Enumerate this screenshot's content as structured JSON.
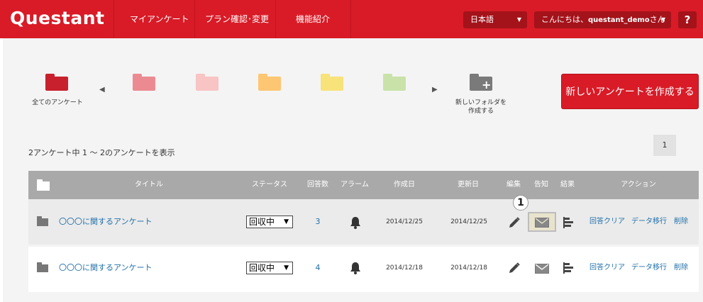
{
  "header": {
    "logo": "Questant",
    "nav": [
      "マイアンケート",
      "プラン確認･変更",
      "機能紹介"
    ],
    "language": "日本語",
    "greeting_prefix": "こんにちは、",
    "username": "questant_demo",
    "greeting_suffix": "さん",
    "help": "?"
  },
  "folders": {
    "all_label": "全てのアンケート",
    "new_label_1": "新しいフォルダを",
    "new_label_2": "作成する",
    "colors": [
      "#c8202d",
      "#eb8b91",
      "#f8c4c4",
      "#fdc672",
      "#f8e27a",
      "#c9e2a9",
      "#7a7a7a"
    ]
  },
  "create_button": "新しいアンケートを作成する",
  "count_text": "2アンケート中  1 ～ 2のアンケートを表示",
  "pagination": {
    "current": "1"
  },
  "table": {
    "headers": {
      "title": "タイトル",
      "status": "ステータス",
      "responses": "回答数",
      "alarm": "アラーム",
      "created": "作成日",
      "updated": "更新日",
      "edit": "編集",
      "notify": "告知",
      "results": "結果",
      "actions": "アクション"
    },
    "rows": [
      {
        "title": "〇〇〇に関するアンケート",
        "status": "回収中",
        "responses": "3",
        "created": "2014/12/25",
        "updated": "2014/12/25",
        "actions": [
          "回答クリア",
          "データ移行",
          "削除"
        ]
      },
      {
        "title": "〇〇〇に関するアンケート",
        "status": "回収中",
        "responses": "4",
        "created": "2014/12/18",
        "updated": "2014/12/18",
        "actions": [
          "回答クリア",
          "データ移行",
          "削除"
        ]
      }
    ]
  },
  "callout_label": "1"
}
